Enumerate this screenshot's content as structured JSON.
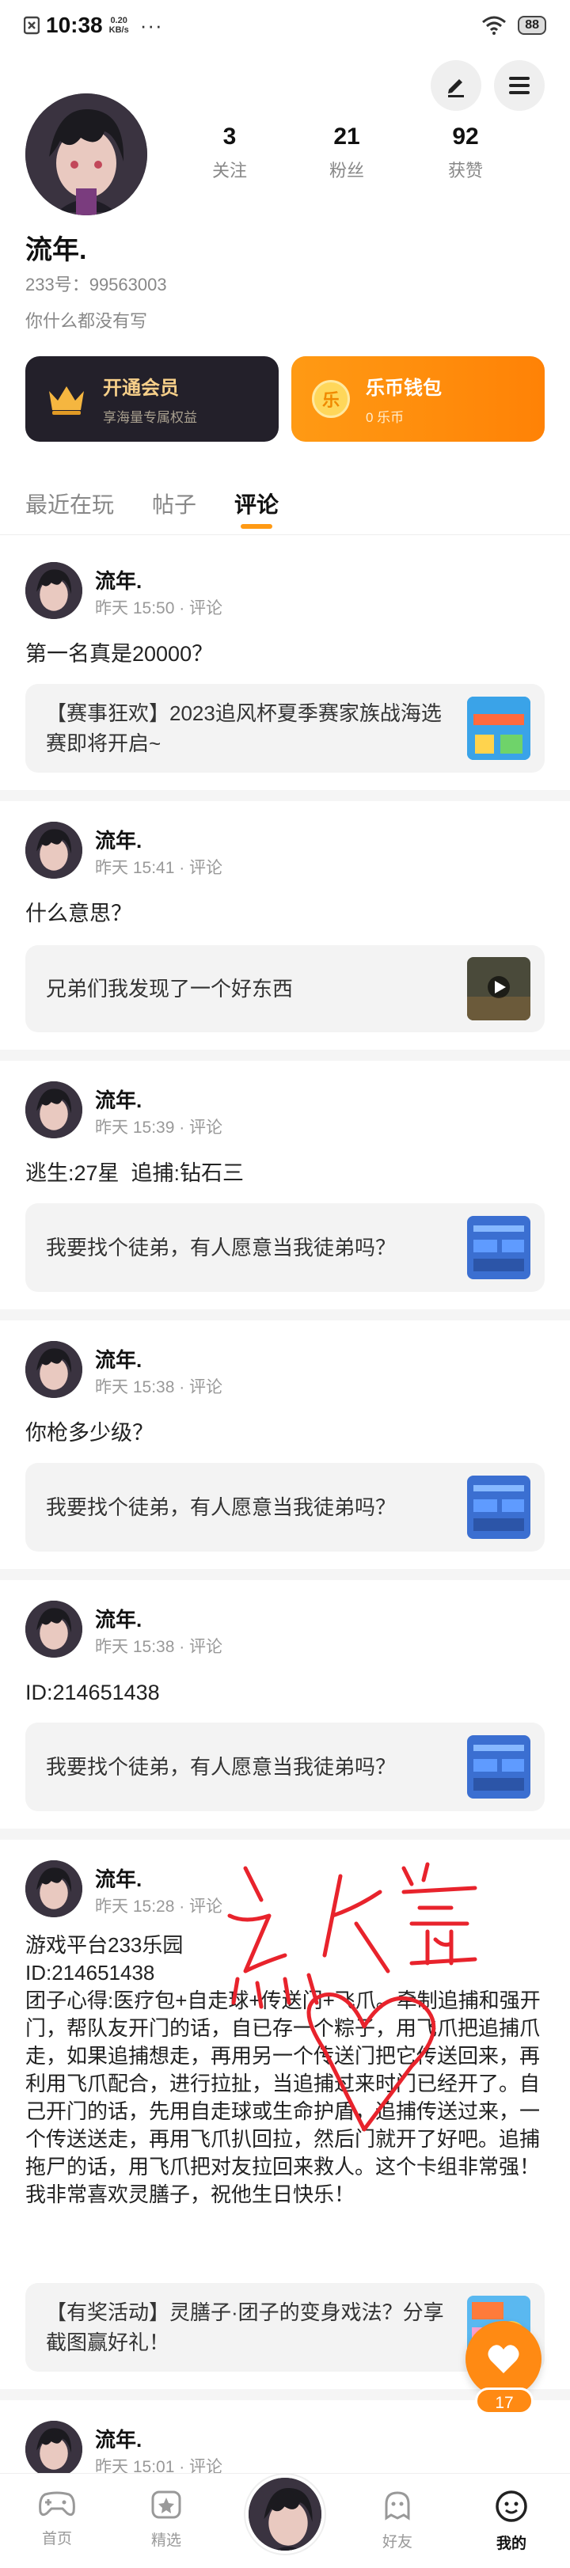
{
  "status_bar": {
    "time": "10:38",
    "speed_value": "0.20",
    "speed_unit": "KB/s",
    "dots": "···",
    "battery": "88"
  },
  "profile": {
    "stats": [
      {
        "value": "3",
        "label": "关注"
      },
      {
        "value": "21",
        "label": "粉丝"
      },
      {
        "value": "92",
        "label": "获赞"
      }
    ],
    "name": "流年.",
    "uid": "233号：99563003",
    "bio": "你什么都没有写"
  },
  "cards": {
    "vip": {
      "title": "开通会员",
      "subtitle": "享海量专属权益"
    },
    "wallet": {
      "title": "乐币钱包",
      "subtitle": "0 乐币",
      "coin_symbol": "乐"
    }
  },
  "tabs": [
    {
      "label": "最近在玩"
    },
    {
      "label": "帖子"
    },
    {
      "label": "评论"
    }
  ],
  "comments": [
    {
      "name": "流年.",
      "meta": "昨天 15:50 · 评论",
      "text": "第一名真是20000？",
      "ref": "【赛事狂欢】2023追风杯夏季赛家族战海选赛即将开启~"
    },
    {
      "name": "流年.",
      "meta": "昨天 15:41 · 评论",
      "text": "什么意思？",
      "ref": "兄弟们我发现了一个好东西"
    },
    {
      "name": "流年.",
      "meta": "昨天 15:39 · 评论",
      "text": "逃生:27星  追捕:钻石三",
      "ref": "我要找个徒弟，有人愿意当我徒弟吗？"
    },
    {
      "name": "流年.",
      "meta": "昨天 15:38 · 评论",
      "text": "你枪多少级？",
      "ref": "我要找个徒弟，有人愿意当我徒弟吗？"
    },
    {
      "name": "流年.",
      "meta": "昨天 15:38 · 评论",
      "text": "ID:214651438",
      "ref": "我要找个徒弟，有人愿意当我徒弟吗？"
    },
    {
      "name": "流年.",
      "meta": "昨天 15:28 · 评论",
      "text": "游戏平台233乐园\nID:214651438\n团子心得:医疗包+自走球+传送门+飞爪。牵制追捕和强开门，帮队友开门的话，自已存一个粽子，用飞爪把追捕爪走，如果追捕想走，再用另一个传送门把它传送回来，再利用飞爪配合，进行拉扯，当追捕过来时门已经开了。自己开门的话，先用自走球或生命护盾，追捕传送过来，一个传送送走，再用飞爪扒回拉，然后门就开了好吧。追捕拖尸的话，用飞爪把对友拉回来救人。这个卡组非常强！我非常喜欢灵膳子，祝他生日快乐！",
      "ref": "【有奖活动】灵膳子·团子的变身戏法？分享截图赢好礼！"
    },
    {
      "name": "流年.",
      "meta": "昨天 15:01 · 评论"
    }
  ],
  "fab": {
    "count": "17"
  },
  "bottom_nav": [
    {
      "label": "首页"
    },
    {
      "label": "精选"
    },
    {
      "label": "好友"
    },
    {
      "label": "我的"
    }
  ],
  "colors": {
    "accent": "#ff9a14",
    "dark_card": "#23202a",
    "handwriting": "#e8232c"
  },
  "icons": [
    "edit-icon",
    "menu-icon",
    "crown-icon",
    "heart-icon",
    "gamepad-icon",
    "star-icon",
    "ghost-icon",
    "smile-icon"
  ]
}
